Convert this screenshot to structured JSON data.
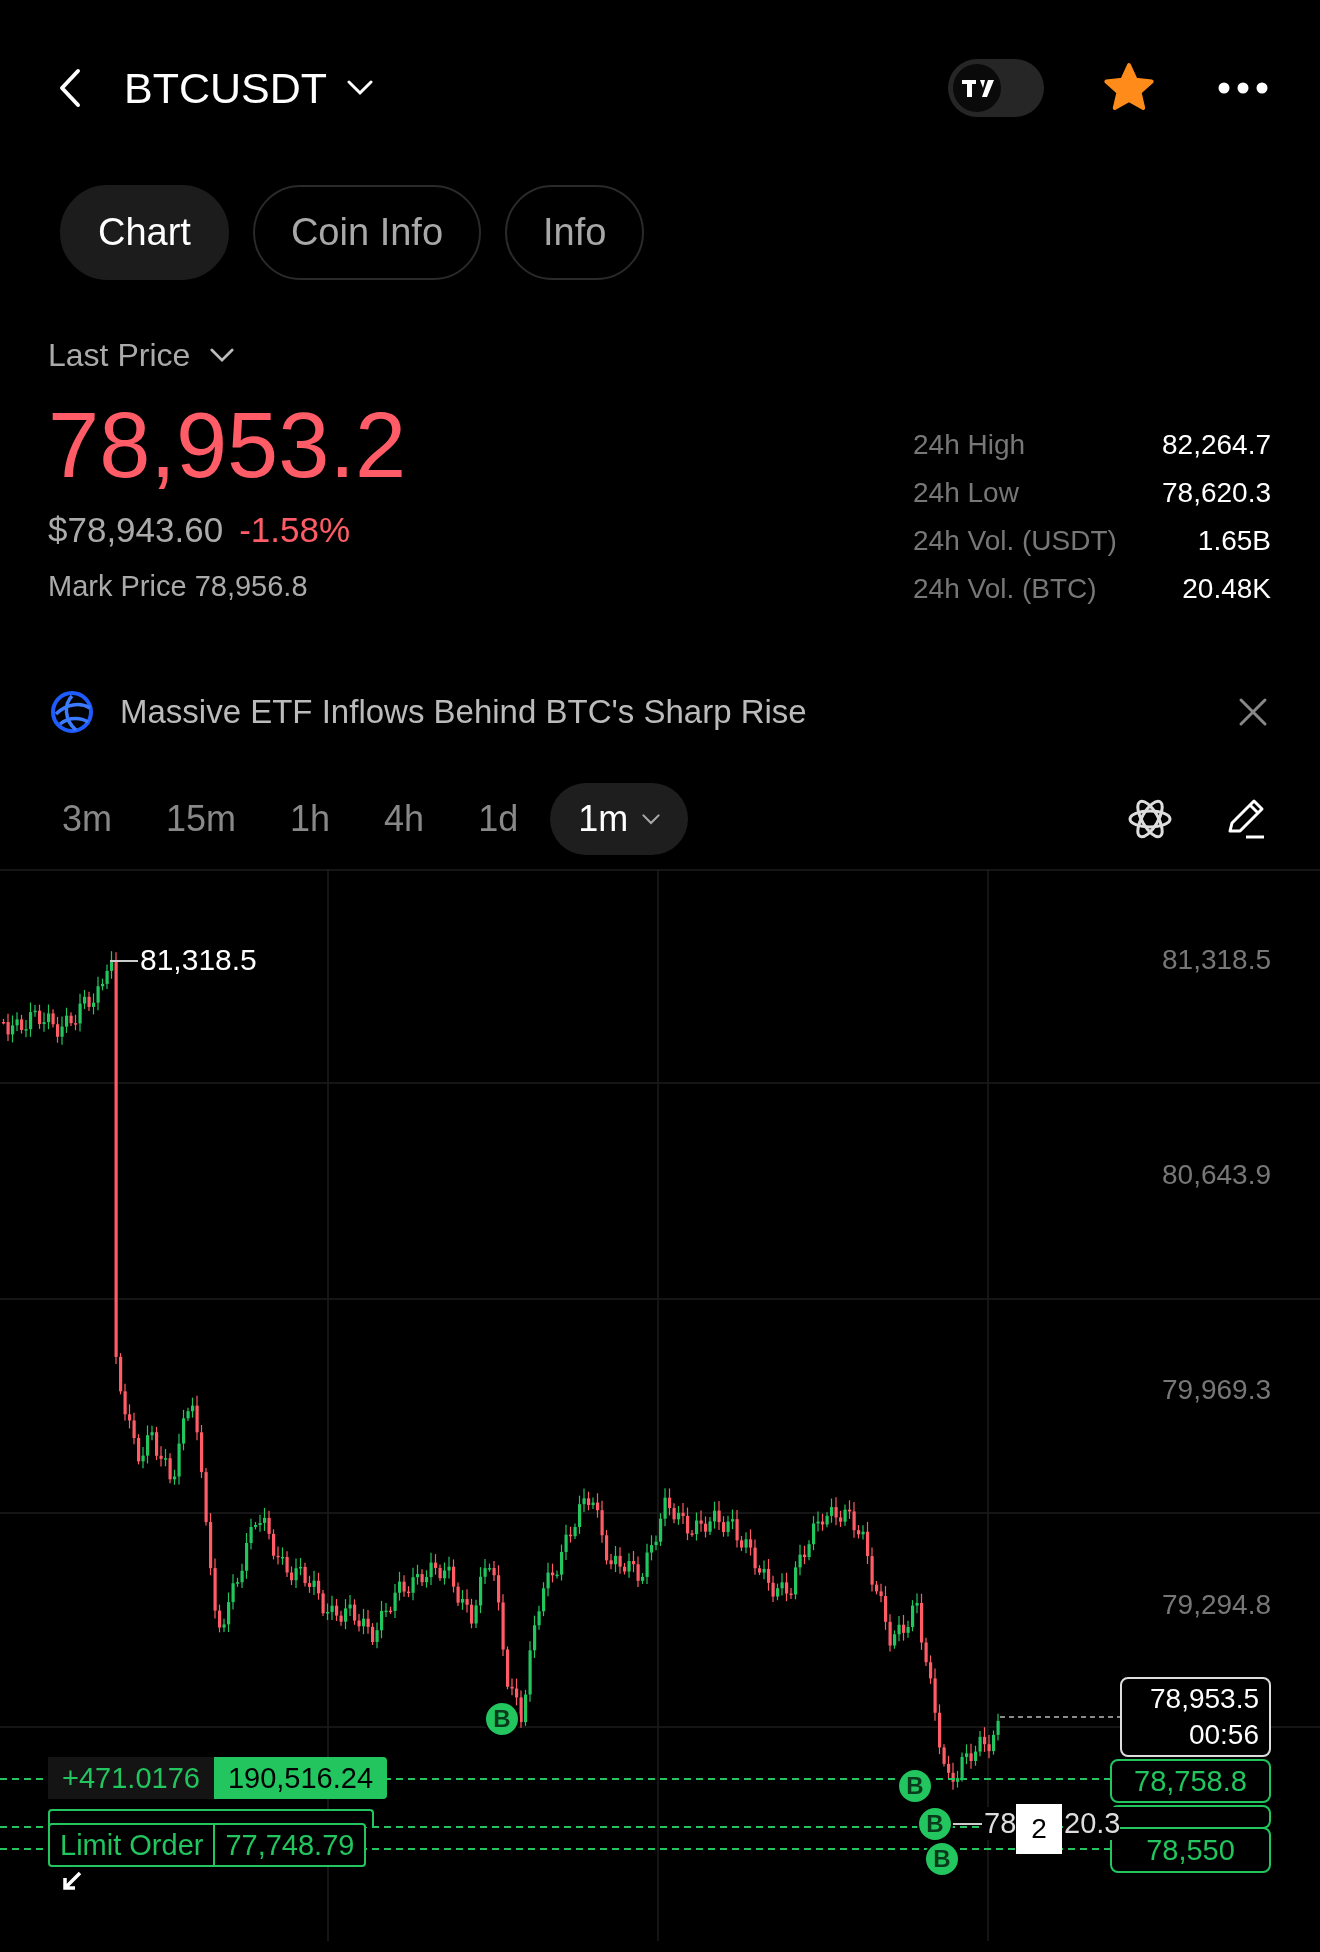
{
  "header": {
    "title": "BTCUSDT",
    "tv_toggle": {
      "on": false
    },
    "favorite": true
  },
  "tabs": [
    {
      "label": "Chart",
      "selected": true
    },
    {
      "label": "Coin Info",
      "selected": false
    },
    {
      "label": "Info",
      "selected": false
    }
  ],
  "price": {
    "label": "Last Price",
    "last": "78,953.2",
    "usd": "$78,943.60",
    "change": "-1.58%",
    "mark": "Mark Price 78,956.8"
  },
  "stats": [
    {
      "label": "24h High",
      "value": "82,264.7"
    },
    {
      "label": "24h Low",
      "value": "78,620.3"
    },
    {
      "label": "24h Vol. (USDT)",
      "value": "1.65B"
    },
    {
      "label": "24h Vol. (BTC)",
      "value": "20.48K"
    }
  ],
  "news": {
    "headline": "Massive ETF Inflows Behind BTC's Sharp Rise"
  },
  "timeframes": [
    {
      "label": "3m",
      "selected": false
    },
    {
      "label": "15m",
      "selected": false
    },
    {
      "label": "1h",
      "selected": false
    },
    {
      "label": "4h",
      "selected": false
    },
    {
      "label": "1d",
      "selected": false
    },
    {
      "label": "1m",
      "selected": true
    }
  ],
  "chart": {
    "high_label": "81,318.5",
    "price_axis": [
      "81,318.5",
      "80,643.9",
      "79,969.3",
      "79,294.8"
    ],
    "current_price": {
      "price": "78,953.5",
      "countdown": "00:56"
    },
    "position": {
      "pnl": "+471.0176",
      "value": "190,516.24",
      "price": "78,758.8"
    },
    "limit_order": {
      "label": "Limit Order",
      "value": "77,748.79",
      "price": "78,550"
    },
    "markers": [
      {
        "text": "B"
      },
      {
        "text": "B"
      },
      {
        "text": "B"
      },
      {
        "text": "B"
      }
    ],
    "low_label": {
      "parts": [
        "78",
        "20.3"
      ],
      "badge": "2"
    }
  }
}
